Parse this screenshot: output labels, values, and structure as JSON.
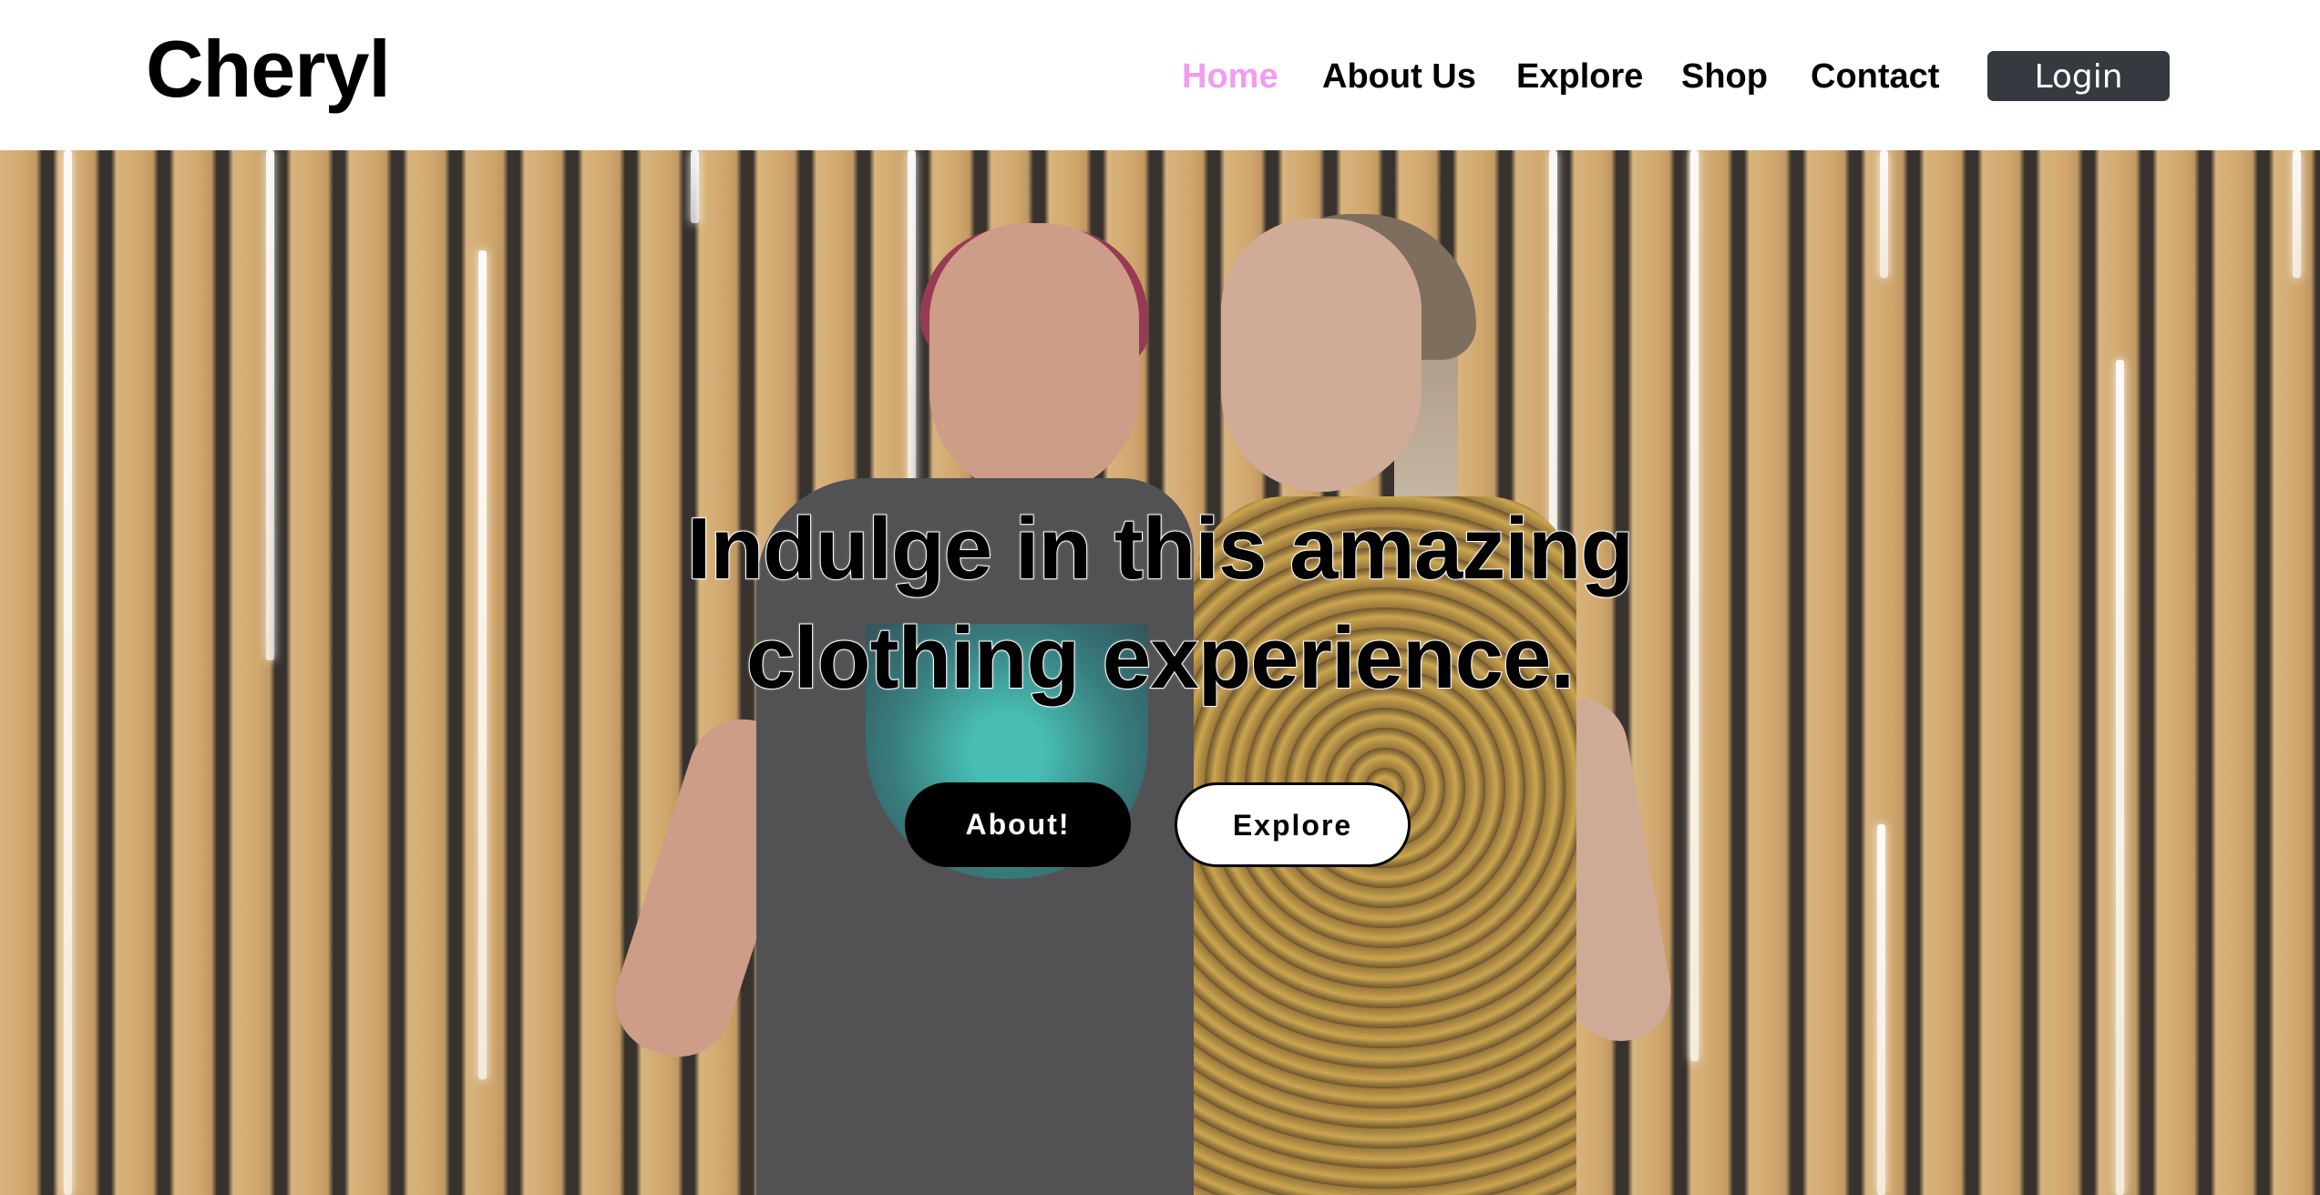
{
  "header": {
    "logo": "Cheryl",
    "nav": [
      {
        "label": "Home",
        "active": true
      },
      {
        "label": "About Us",
        "active": false
      },
      {
        "label": "Explore",
        "active": false
      },
      {
        "label": "Shop",
        "active": false
      },
      {
        "label": "Contact",
        "active": false
      }
    ],
    "login_label": "Login"
  },
  "hero": {
    "title_line1": "Indulge in this amazing",
    "title_line2": "clothing experience.",
    "primary_button": "About!",
    "secondary_button": "Explore",
    "background_image": "two-women-in-evening-gowns-against-wooden-slat-wall"
  },
  "colors": {
    "active_nav": "#f29cf0",
    "login_bg": "#353940",
    "text": "#000000",
    "background": "#ffffff"
  }
}
